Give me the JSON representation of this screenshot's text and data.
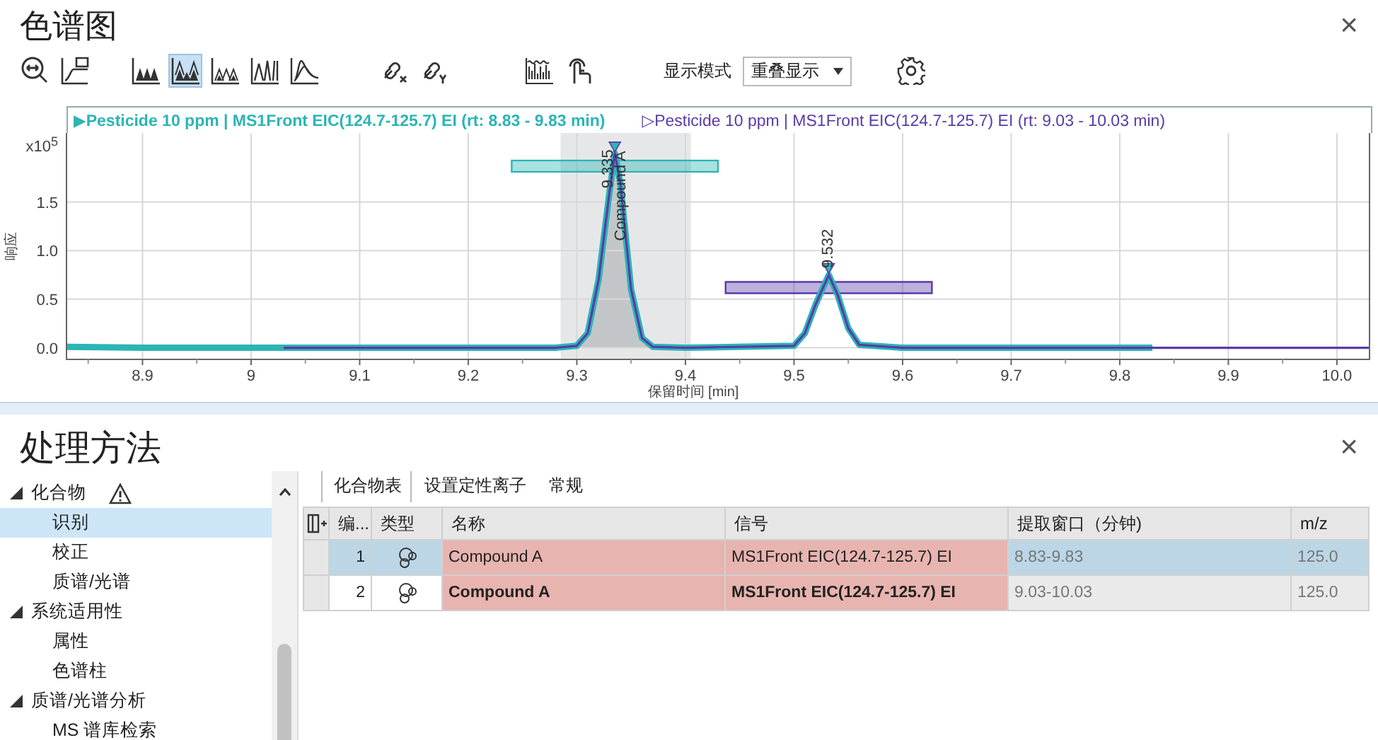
{
  "chromatogram": {
    "title": "色谱图",
    "close": "×",
    "toolbar": [
      {
        "kind": "zoom-x",
        "selected": false
      },
      {
        "kind": "baseline",
        "selected": false
      },
      {
        "kind": "peaks-filled",
        "selected": false
      },
      {
        "kind": "peaks-overlay",
        "selected": true
      },
      {
        "kind": "peaks-outline",
        "selected": false
      },
      {
        "kind": "peaks-lines",
        "selected": false
      },
      {
        "kind": "peaks-offset",
        "selected": false
      },
      {
        "kind": "link-x",
        "selected": false
      },
      {
        "kind": "link-y",
        "selected": false
      },
      {
        "kind": "stack-chart",
        "selected": false
      },
      {
        "kind": "touch",
        "selected": false
      }
    ],
    "display_mode": {
      "label": "显示模式",
      "value": "重叠显示"
    },
    "legend": [
      {
        "marker": "▶",
        "selected": true
      },
      {
        "marker": "▷",
        "selected": false
      }
    ],
    "y_multiplier": {
      "base": "x10",
      "exponent": "5"
    },
    "chart_data": {
      "type": "line",
      "xlabel": "保留时间 [min]",
      "ylabel": "响应",
      "x": [
        8.83,
        8.9,
        9.0,
        9.03,
        9.1,
        9.2,
        9.28,
        9.3,
        9.31,
        9.32,
        9.33,
        9.335,
        9.34,
        9.35,
        9.36,
        9.37,
        9.4,
        9.5,
        9.51,
        9.52,
        9.532,
        9.54,
        9.55,
        9.56,
        9.6,
        9.7,
        9.8,
        9.83,
        9.9,
        10.0,
        10.03
      ],
      "series": [
        {
          "name": "Pesticide 10 ppm | MS1Front EIC(124.7-125.7) EI (rt: 8.83 - 9.83 min)",
          "color": "#2bb5b5",
          "values": [
            0.01,
            0.0,
            0.0,
            0.0,
            0.0,
            0.0,
            0.0,
            0.02,
            0.15,
            0.7,
            1.6,
            2.0,
            1.7,
            0.6,
            0.1,
            0.01,
            0.0,
            0.02,
            0.15,
            0.45,
            0.75,
            0.55,
            0.2,
            0.03,
            0.0,
            0.0,
            0.0,
            0.0,
            null,
            null,
            null
          ]
        },
        {
          "name": "Pesticide 10 ppm | MS1Front EIC(124.7-125.7) EI (rt: 9.03 - 10.03 min)",
          "color": "#5a3aa8",
          "values": [
            null,
            null,
            null,
            0.0,
            0.0,
            0.0,
            0.0,
            0.02,
            0.15,
            0.7,
            1.6,
            2.0,
            1.7,
            0.6,
            0.1,
            0.01,
            0.0,
            0.02,
            0.15,
            0.45,
            0.75,
            0.55,
            0.2,
            0.03,
            0.0,
            0.0,
            0.0,
            0.0,
            0.0,
            0.0,
            0.0
          ]
        }
      ],
      "xlim": [
        8.83,
        10.03
      ],
      "ylim": [
        -0.12,
        2.21
      ],
      "grid": true,
      "xticks": [
        8.9,
        9.0,
        9.1,
        9.2,
        9.3,
        9.4,
        9.5,
        9.6,
        9.7,
        9.8,
        9.9,
        {
          "value": 10.0,
          "label": "10.0"
        }
      ],
      "yticks": [
        {
          "value": 0,
          "label": "0.0"
        },
        0.5,
        {
          "value": 1,
          "label": "1.0"
        },
        1.5
      ],
      "annotations": [
        {
          "x": 9.329,
          "y": 1.64,
          "text": "9.335"
        },
        {
          "x": 9.341,
          "y": 1.1,
          "text": "Compound A"
        },
        {
          "x": 9.532,
          "y": 0.82,
          "text": "9.532"
        }
      ]
    }
  },
  "processing": {
    "title": "处理方法",
    "close": "×",
    "tree": [
      {
        "label": "化合物",
        "warning": true,
        "expanded": true,
        "children": [
          {
            "label": "识别",
            "selected": true
          },
          {
            "label": "校正",
            "selected": false
          },
          {
            "label": "质谱/光谱",
            "selected": false
          }
        ]
      },
      {
        "label": "系统适用性",
        "warning": false,
        "expanded": true,
        "children": [
          {
            "label": "属性",
            "selected": false
          },
          {
            "label": "色谱柱",
            "selected": false
          }
        ]
      },
      {
        "label": "质谱/光谱分析",
        "warning": false,
        "expanded": true,
        "children": [
          {
            "label": "MS 谱库检索",
            "selected": false
          }
        ]
      }
    ],
    "tabs": [
      {
        "label": "化合物表",
        "selected": true
      },
      {
        "label": "设置定性离子",
        "selected": false
      },
      {
        "label": "常规",
        "selected": false
      }
    ],
    "table": {
      "columns": [
        "编...",
        "类型",
        "名称",
        "信号",
        "提取窗口（分钟)",
        "m/z"
      ],
      "rows": [
        {
          "selected": true,
          "emphasized": false,
          "number": "1",
          "name": "Compound A",
          "signal": "MS1Front EIC(124.7-125.7) EI",
          "window": "8.83-9.83",
          "mz": "125.0"
        },
        {
          "selected": false,
          "emphasized": true,
          "number": "2",
          "name": "Compound A",
          "signal": "MS1Front EIC(124.7-125.7) EI",
          "window": "9.03-10.03",
          "mz": "125.0"
        }
      ]
    }
  }
}
